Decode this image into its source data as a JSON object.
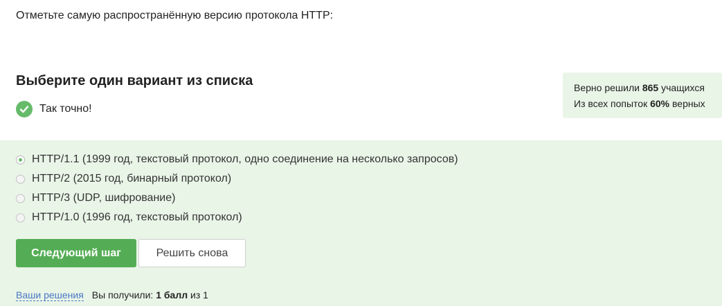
{
  "question": {
    "text": "Отметьте самую распространённую версию протокола HTTP:"
  },
  "quiz": {
    "heading": "Выберите один вариант из списка",
    "feedback": "Так точно!"
  },
  "stats": {
    "solved_prefix": "Верно решили ",
    "solved_count": "865",
    "solved_suffix": " учащихся",
    "attempts_prefix": "Из всех попыток ",
    "attempts_percent": "60%",
    "attempts_suffix": " верных"
  },
  "options": [
    {
      "label": "HTTP/1.1 (1999 год, текстовый протокол, одно соединение на несколько запросов)",
      "selected": true
    },
    {
      "label": "HTTP/2 (2015 год, бинарный протокол)",
      "selected": false
    },
    {
      "label": "HTTP/3 (UDP, шифрование)",
      "selected": false
    },
    {
      "label": "HTTP/1.0 (1996 год, текстовый протокол)",
      "selected": false
    }
  ],
  "buttons": {
    "next_step": "Следующий шаг",
    "retry": "Решить снова"
  },
  "footer": {
    "solutions_link": "Ваши решения",
    "score_prefix": "Вы получили: ",
    "score_value": "1 балл",
    "score_suffix": " из 1"
  },
  "colors": {
    "accent_green": "#54ad54",
    "panel_green": "#e9f5e7",
    "link_blue": "#4a77c4"
  },
  "icons": {
    "feedback": "check-circle-icon",
    "radio": "radio-icon"
  }
}
